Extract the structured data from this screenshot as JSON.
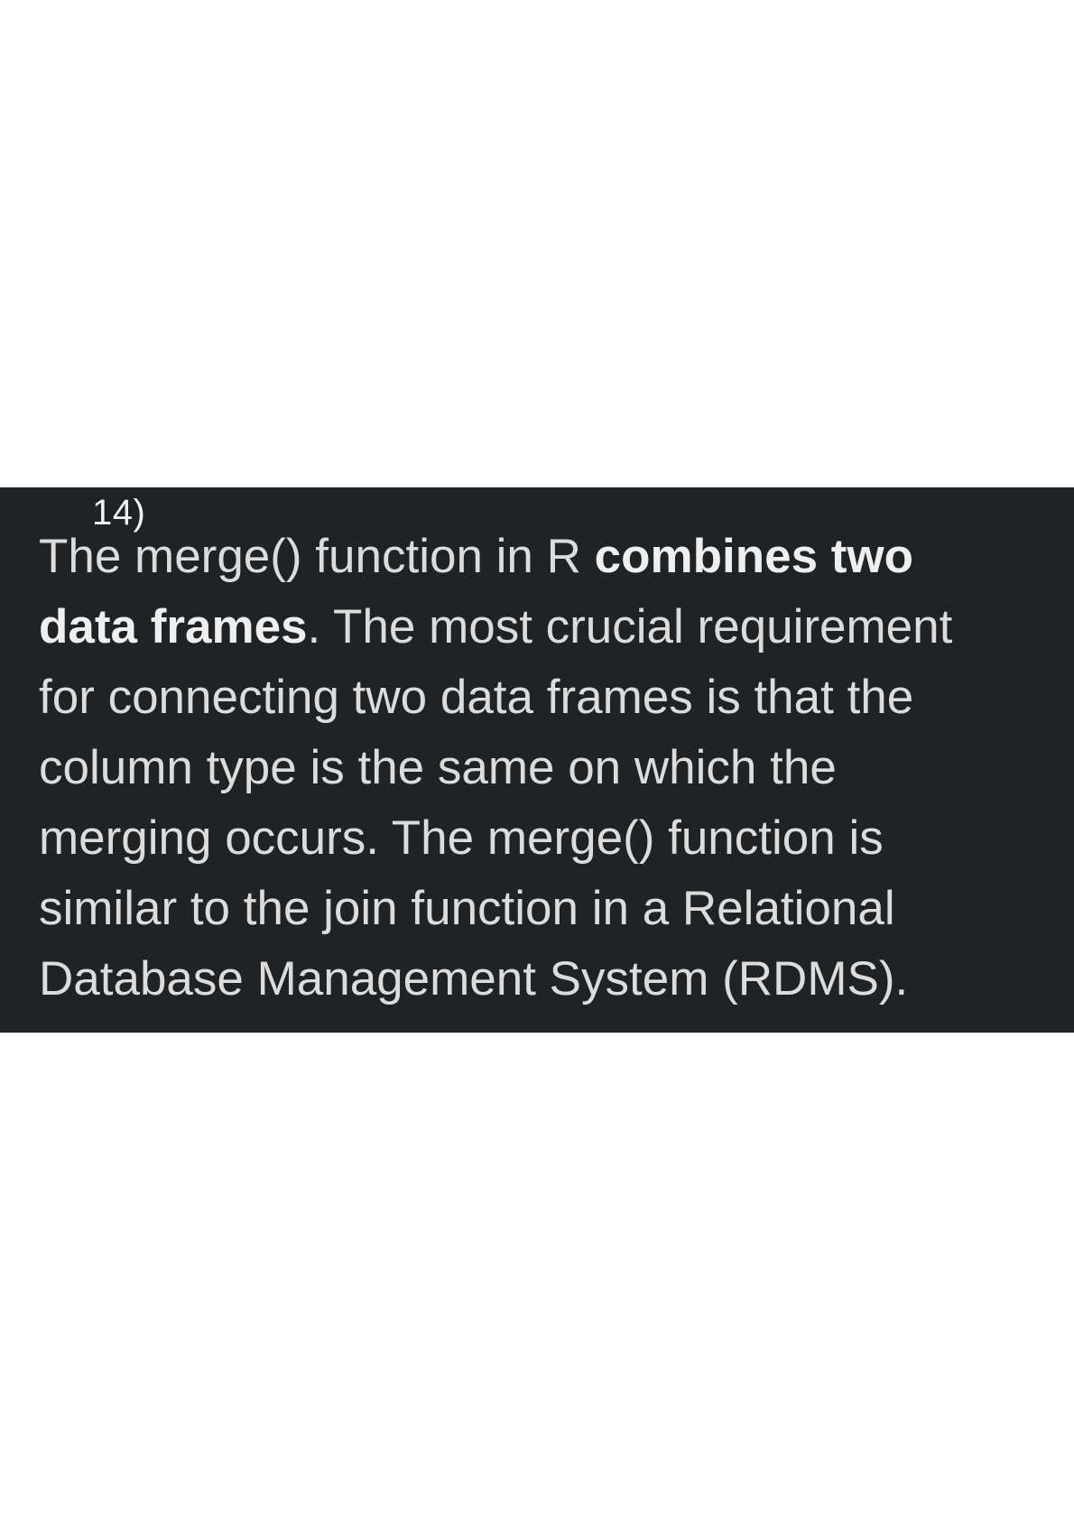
{
  "question_number": "14)",
  "answer": {
    "line1_pre": "The merge() function in R ",
    "line1_bold": "combines two",
    "line2_bold": "data frames",
    "line2_post": ". The most crucial requirement",
    "line3": "for connecting two data frames is that the",
    "line4": "column type is the same on which the",
    "line5": "merging occurs. The merge() function is",
    "line6": "similar to the join function in a Relational",
    "line7": "Database Management System (RDMS)."
  },
  "colors": {
    "page_background": "#fefefe",
    "panel_background": "#202325",
    "text": "#dcdcdc",
    "bold_text": "#efefef"
  }
}
